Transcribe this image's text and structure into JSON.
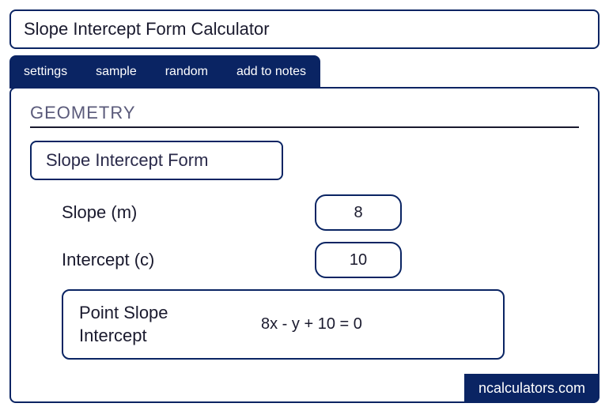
{
  "title": "Slope Intercept Form Calculator",
  "tabs": {
    "settings": "settings",
    "sample": "sample",
    "random": "random",
    "add_to_notes": "add to notes"
  },
  "section": "GEOMETRY",
  "form_title": "Slope Intercept Form",
  "inputs": {
    "slope_label": "Slope (m)",
    "slope_value": "8",
    "intercept_label": "Intercept (c)",
    "intercept_value": "10"
  },
  "result": {
    "label": "Point Slope Intercept",
    "value": "8x - y + 10 = 0"
  },
  "brand": "ncalculators.com"
}
